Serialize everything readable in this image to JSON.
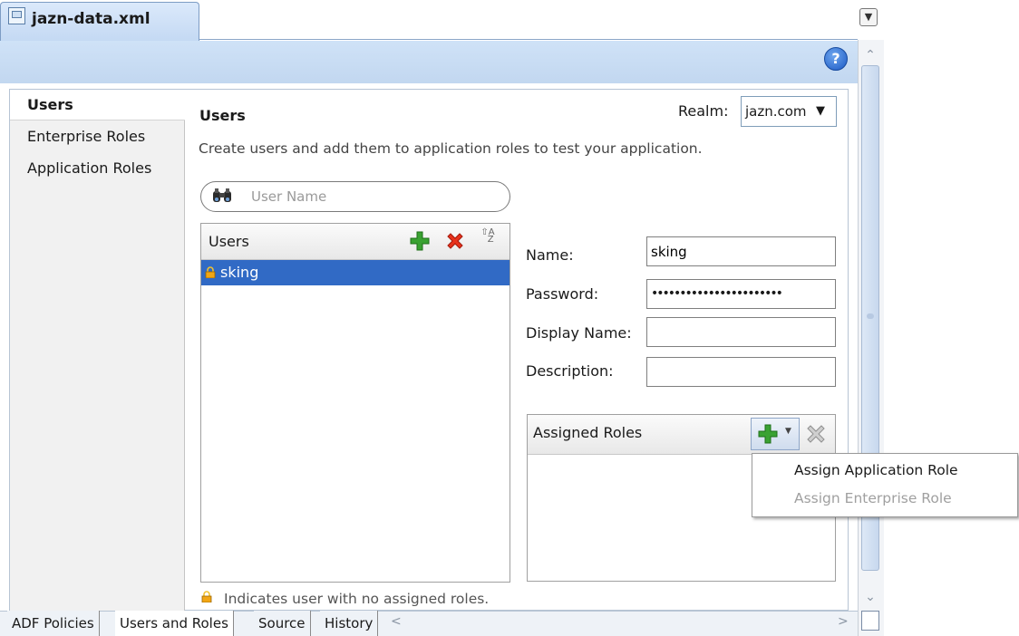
{
  "editor": {
    "file_tab": "jazn-data.xml",
    "help_label": "?"
  },
  "sidebar": {
    "items": [
      {
        "label": "Users",
        "active": true
      },
      {
        "label": "Enterprise Roles",
        "active": false
      },
      {
        "label": "Application Roles",
        "active": false
      }
    ]
  },
  "main": {
    "title": "Users",
    "description": "Create users and add them to application roles to test your application.",
    "realm_label": "Realm:",
    "realm_value": "jazn.com",
    "search_placeholder": "User Name"
  },
  "users_list": {
    "header": "Users",
    "rows": [
      {
        "name": "sking",
        "locked": true,
        "selected": true
      }
    ]
  },
  "details": {
    "name_label": "Name:",
    "name_value": "sking",
    "password_label": "Password:",
    "password_value": "•••••••••••••••••••••••",
    "display_name_label": "Display Name:",
    "display_name_value": "",
    "description_label": "Description:",
    "description_value": ""
  },
  "assigned_roles": {
    "header": "Assigned Roles",
    "menu_items": [
      {
        "label": "Assign Application Role",
        "enabled": true
      },
      {
        "label": "Assign Enterprise Role",
        "enabled": false
      }
    ]
  },
  "legend": "Indicates user with no assigned roles.",
  "bottom_tabs": [
    {
      "label": "ADF Policies",
      "active": false
    },
    {
      "label": "Users and Roles",
      "active": true
    },
    {
      "label": "Source",
      "active": false
    },
    {
      "label": "History",
      "active": false
    }
  ],
  "colors": {
    "selection": "#316ac5",
    "header_band": "#c7dbf3",
    "add_green": "#3aa232",
    "delete_red": "#e8321c",
    "disabled_text": "#a0a0a0"
  },
  "icons": [
    "xml-file-icon",
    "tab-menu-icon",
    "help-icon",
    "binoculars-icon",
    "add-icon",
    "delete-icon",
    "sort-icon",
    "lock-icon",
    "dropdown-arrow-icon"
  ]
}
